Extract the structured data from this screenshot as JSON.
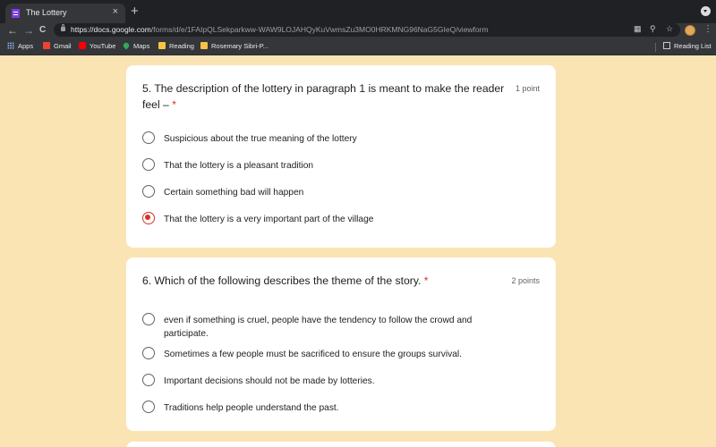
{
  "browser": {
    "tab_title": "The Lottery",
    "tab_close": "×",
    "new_tab": "+",
    "back": "←",
    "forward": "→",
    "reload": "C",
    "url_host": "https://docs.google.com",
    "url_path": "/forms/d/e/1FAIpQLSekparkww-WAW9LOJAHQyKuVwmsZu3MO0HRKMNG96NaG5GIeQ/viewform",
    "icons": [
      "qr-code-icon",
      "zoom-icon",
      "star-icon",
      "avatar",
      "menu-icon"
    ]
  },
  "bookmarks": [
    {
      "label": "Apps",
      "icon": "apps-icon"
    },
    {
      "label": "Gmail",
      "icon": "gmail-icon"
    },
    {
      "label": "YouTube",
      "icon": "youtube-icon"
    },
    {
      "label": "Maps",
      "icon": "maps-icon"
    },
    {
      "label": "Reading",
      "icon": "folder-icon"
    },
    {
      "label": "Rosemary Sibri-P...",
      "icon": "folder-icon"
    }
  ],
  "reading_list": "Reading List",
  "questions": [
    {
      "title": "5. The description of the lottery in paragraph 1 is meant to make the reader feel –",
      "required": "*",
      "points": "1 point",
      "options": [
        {
          "label": "Suspicious about the true meaning of the lottery",
          "selected": false
        },
        {
          "label": "That the lottery is a pleasant tradition",
          "selected": false
        },
        {
          "label": "Certain something bad will happen",
          "selected": false
        },
        {
          "label": "That the lottery is a very important part of the village",
          "selected": true
        }
      ]
    },
    {
      "title": "6. Which of the following describes the theme of the story.",
      "required": "*",
      "points": "2 points",
      "options": [
        {
          "label": "even if something is cruel, people have the tendency to follow the crowd and participate.",
          "selected": false
        },
        {
          "label": "Sometimes a few people must be sacrificed to ensure the groups survival.",
          "selected": false
        },
        {
          "label": "Important decisions should not be made by lotteries.",
          "selected": false
        },
        {
          "label": "Traditions help people understand the past.",
          "selected": false
        }
      ]
    }
  ],
  "colors": {
    "background": "#fbe4b4",
    "accent": "#d93025",
    "chrome_dark": "#202124",
    "chrome_mid": "#35363a"
  }
}
